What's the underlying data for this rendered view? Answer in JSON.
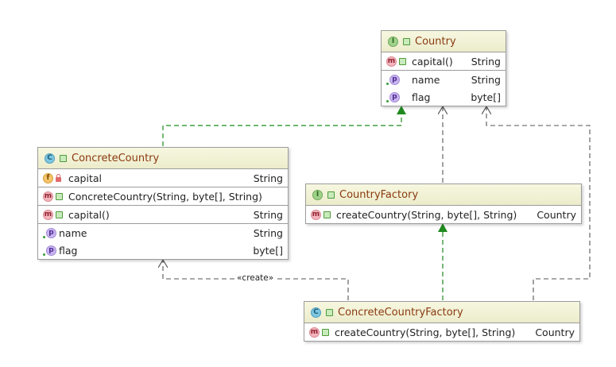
{
  "nodes": {
    "country": {
      "kind_badge": "I",
      "title": "Country",
      "rows": [
        {
          "badge": "m",
          "name": "capital()",
          "type": "String"
        },
        {
          "badge": "p",
          "name": "name",
          "type": "String"
        },
        {
          "badge": "p",
          "name": "flag",
          "type": "byte[]"
        }
      ]
    },
    "concrete_country": {
      "kind_badge": "C",
      "title": "ConcreteCountry",
      "rows": [
        {
          "badge": "f",
          "name": "capital",
          "type": "String"
        },
        {
          "badge": "m",
          "name": "ConcreteCountry(String, byte[], String)",
          "type": ""
        },
        {
          "badge": "m",
          "name": "capital()",
          "type": "String"
        },
        {
          "badge": "p",
          "name": "name",
          "type": "String"
        },
        {
          "badge": "p",
          "name": "flag",
          "type": "byte[]"
        }
      ]
    },
    "country_factory": {
      "kind_badge": "I",
      "title": "CountryFactory",
      "rows": [
        {
          "badge": "m",
          "name": "createCountry(String, byte[], String)",
          "type": "Country"
        }
      ]
    },
    "concrete_country_factory": {
      "kind_badge": "C",
      "title": "ConcreteCountryFactory",
      "rows": [
        {
          "badge": "m",
          "name": "createCountry(String, byte[], String)",
          "type": "Country"
        }
      ]
    }
  },
  "edges": {
    "create_label": "«create»"
  },
  "colors": {
    "realization": "#1f8a1f",
    "dependency": "#555555",
    "title_text": "#8a3a10"
  }
}
